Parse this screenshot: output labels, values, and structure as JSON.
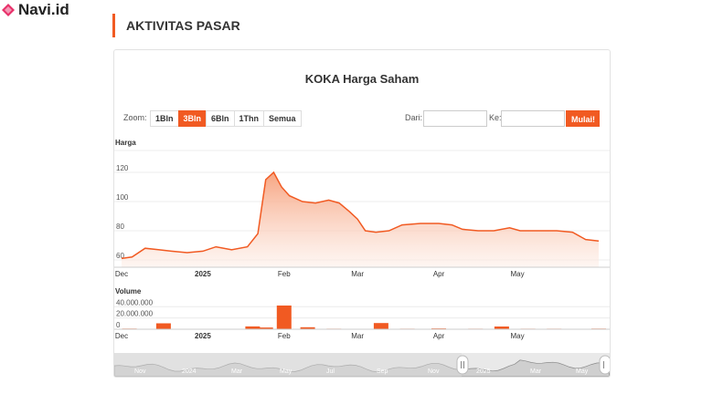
{
  "brand": {
    "name": "Navi.id",
    "accent": "#f15a22"
  },
  "section": {
    "title": "AKTIVITAS PASAR"
  },
  "chart_controls": {
    "zoom_label": "Zoom:",
    "zoom_options": [
      "1Bln",
      "3Bln",
      "6Bln",
      "1Thn",
      "Semua"
    ],
    "zoom_active": "3Bln",
    "from_label": "Dari:",
    "to_label": "Ke:",
    "from_value": "",
    "to_value": "",
    "submit_label": "Mulai!"
  },
  "chart_data": [
    {
      "type": "area",
      "title": "KOKA Harga Saham",
      "ylabel": "Harga",
      "yticks": [
        60,
        80,
        100,
        120
      ],
      "ylim": [
        55,
        135
      ],
      "x_ticks": [
        {
          "date": "2024-12-01",
          "label": "Dec"
        },
        {
          "date": "2025-01-01",
          "label": "2025"
        },
        {
          "date": "2025-02-01",
          "label": "Feb"
        },
        {
          "date": "2025-03-01",
          "label": "Mar"
        },
        {
          "date": "2025-04-01",
          "label": "Apr"
        },
        {
          "date": "2025-05-01",
          "label": "May"
        }
      ],
      "x_range": [
        "2024-12-01",
        "2025-06-01"
      ],
      "points": [
        [
          "2024-12-01",
          61
        ],
        [
          "2024-12-05",
          62
        ],
        [
          "2024-12-10",
          68
        ],
        [
          "2024-12-15",
          67
        ],
        [
          "2024-12-20",
          66
        ],
        [
          "2024-12-26",
          65
        ],
        [
          "2025-01-01",
          66
        ],
        [
          "2025-01-06",
          69
        ],
        [
          "2025-01-12",
          67
        ],
        [
          "2025-01-18",
          69
        ],
        [
          "2025-01-22",
          78
        ],
        [
          "2025-01-25",
          115
        ],
        [
          "2025-01-28",
          120
        ],
        [
          "2025-01-31",
          110
        ],
        [
          "2025-02-03",
          104
        ],
        [
          "2025-02-08",
          100
        ],
        [
          "2025-02-13",
          99
        ],
        [
          "2025-02-18",
          101
        ],
        [
          "2025-02-22",
          99
        ],
        [
          "2025-02-26",
          93
        ],
        [
          "2025-03-01",
          88
        ],
        [
          "2025-03-04",
          80
        ],
        [
          "2025-03-08",
          79
        ],
        [
          "2025-03-13",
          80
        ],
        [
          "2025-03-18",
          84
        ],
        [
          "2025-03-25",
          85
        ],
        [
          "2025-04-01",
          85
        ],
        [
          "2025-04-06",
          84
        ],
        [
          "2025-04-10",
          81
        ],
        [
          "2025-04-16",
          80
        ],
        [
          "2025-04-22",
          80
        ],
        [
          "2025-04-28",
          82
        ],
        [
          "2025-05-02",
          80
        ],
        [
          "2025-05-08",
          80
        ],
        [
          "2025-05-16",
          80
        ],
        [
          "2025-05-22",
          79
        ],
        [
          "2025-05-27",
          74
        ],
        [
          "2025-06-01",
          73
        ]
      ],
      "colors": {
        "line": "#f15a22",
        "fill_top": "#f7a07b",
        "fill_bottom": "#fdf0ea"
      }
    },
    {
      "type": "bar",
      "ylabel": "Volume",
      "yticks": [
        0,
        20000000,
        40000000
      ],
      "ytick_labels": [
        "0",
        "20.000.000",
        "40.000.000"
      ],
      "ylim": [
        0,
        55000000
      ],
      "x_range": [
        "2024-12-01",
        "2025-06-01"
      ],
      "bars": [
        [
          "2024-12-04",
          1200000
        ],
        [
          "2024-12-17",
          10500000
        ],
        [
          "2025-01-01",
          800000
        ],
        [
          "2025-01-12",
          700000
        ],
        [
          "2025-01-20",
          5000000
        ],
        [
          "2025-01-25",
          3000000
        ],
        [
          "2025-02-01",
          42000000
        ],
        [
          "2025-02-10",
          3500000
        ],
        [
          "2025-02-20",
          900000
        ],
        [
          "2025-03-01",
          700000
        ],
        [
          "2025-03-10",
          11000000
        ],
        [
          "2025-03-20",
          1000000
        ],
        [
          "2025-04-01",
          1500000
        ],
        [
          "2025-04-15",
          900000
        ],
        [
          "2025-04-25",
          4800000
        ],
        [
          "2025-05-05",
          1000000
        ],
        [
          "2025-05-15",
          900000
        ],
        [
          "2025-05-25",
          800000
        ],
        [
          "2025-06-01",
          1200000
        ]
      ],
      "colors": {
        "bar": "#f15a22"
      }
    }
  ],
  "navigator": {
    "labels": [
      "Nov",
      "2024",
      "Mar",
      "May",
      "Jul",
      "Sep",
      "Nov",
      "2025",
      "Mar",
      "May"
    ]
  },
  "x_ticks_volume": [
    "Dec",
    "2025",
    "Feb",
    "Mar",
    "Apr",
    "May"
  ]
}
